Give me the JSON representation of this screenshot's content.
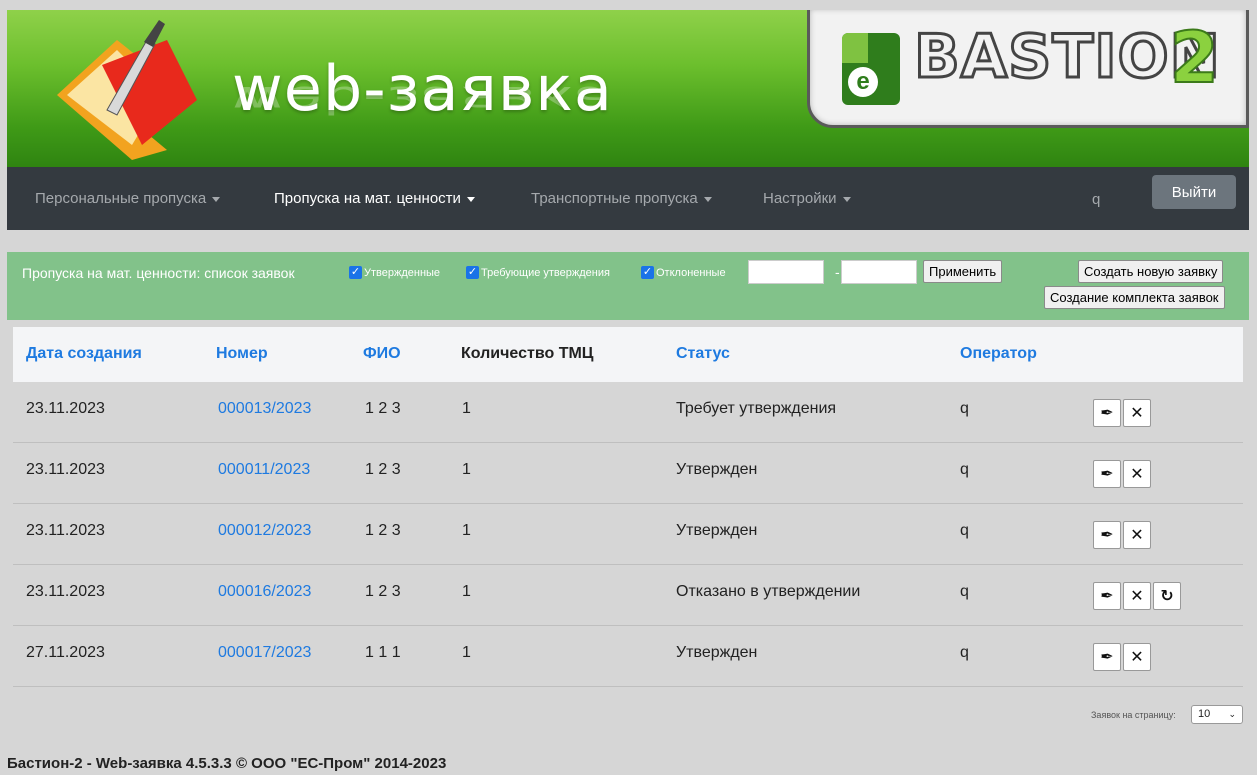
{
  "header": {
    "app_title": "web-заявка",
    "brand_letter": "e",
    "brand_name": "BASTION",
    "brand_number": "2"
  },
  "nav": {
    "items": [
      {
        "label": "Персональные пропуска",
        "active": false
      },
      {
        "label": "Пропуска на мат. ценности",
        "active": true
      },
      {
        "label": "Транспортные пропуска",
        "active": false
      },
      {
        "label": "Настройки",
        "active": false
      }
    ],
    "user": "q",
    "logout_label": "Выйти"
  },
  "toolbar": {
    "title": "Пропуска на мат. ценности: список заявок",
    "filters": [
      {
        "label": "Утвержденные",
        "checked": true
      },
      {
        "label": "Требующие утверждения",
        "checked": true
      },
      {
        "label": "Отклоненные",
        "checked": true
      }
    ],
    "date_from": "",
    "date_to": "",
    "date_separator": "-",
    "apply_label": "Применить",
    "create_label": "Создать новую заявку",
    "create_set_label": "Создание комплекта заявок"
  },
  "table": {
    "columns": [
      "Дата создания",
      "Номер",
      "ФИО",
      "Количество ТМЦ",
      "Статус",
      "Оператор"
    ],
    "rows": [
      {
        "date": "23.11.2023",
        "number": "000013/2023",
        "fio": "1 2 3",
        "qty": "1",
        "status": "Требует утверждения",
        "operator": "q",
        "restore": false
      },
      {
        "date": "23.11.2023",
        "number": "000011/2023",
        "fio": "1 2 3",
        "qty": "1",
        "status": "Утвержден",
        "operator": "q",
        "restore": false
      },
      {
        "date": "23.11.2023",
        "number": "000012/2023",
        "fio": "1 2 3",
        "qty": "1",
        "status": "Утвержден",
        "operator": "q",
        "restore": false
      },
      {
        "date": "23.11.2023",
        "number": "000016/2023",
        "fio": "1 2 3",
        "qty": "1",
        "status": "Отказано в утверждении",
        "operator": "q",
        "restore": true
      },
      {
        "date": "27.11.2023",
        "number": "000017/2023",
        "fio": "1 1 1",
        "qty": "1",
        "status": "Утвержден",
        "operator": "q",
        "restore": false
      }
    ]
  },
  "pager": {
    "label": "Заявок на страницу:",
    "value": "10"
  },
  "footer": {
    "text": "Бастион-2 - Web-заявка 4.5.3.3 © ООО \"ЕС-Пром\" 2014-2023"
  },
  "icons": {
    "edit": "pen-icon",
    "delete": "close-icon",
    "restore": "refresh-icon"
  }
}
